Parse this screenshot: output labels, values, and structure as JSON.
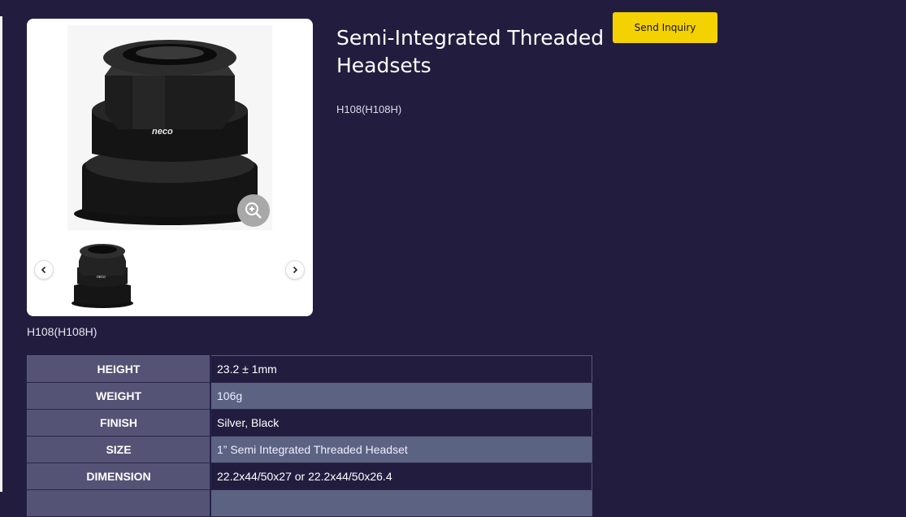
{
  "product": {
    "title": "Semi-Integrated Threaded Headsets",
    "model": "H108(H108H)",
    "caption": "H108(H108H)"
  },
  "actions": {
    "inquiry_label": "Send Inquiry"
  },
  "gallery": {
    "main_image": "headset-photo",
    "zoom_icon": "zoom-in-icon",
    "prev_icon": "chevron-left-icon",
    "next_icon": "chevron-right-icon"
  },
  "specs": [
    {
      "label": "HEIGHT",
      "value": "23.2 ± 1mm"
    },
    {
      "label": "WEIGHT",
      "value": "106g"
    },
    {
      "label": "FINISH",
      "value": "Silver, Black"
    },
    {
      "label": "SIZE",
      "value": "1” Semi Integrated Threaded Headset"
    },
    {
      "label": "DIMENSION",
      "value": "22.2x44/50x27 or 22.2x44/50x26.4"
    },
    {
      "label": "",
      "value": ""
    }
  ],
  "colors": {
    "background": "#221d3f",
    "accent": "#f4d100",
    "key_cell": "#545376",
    "alt_row": "#5c6281"
  }
}
